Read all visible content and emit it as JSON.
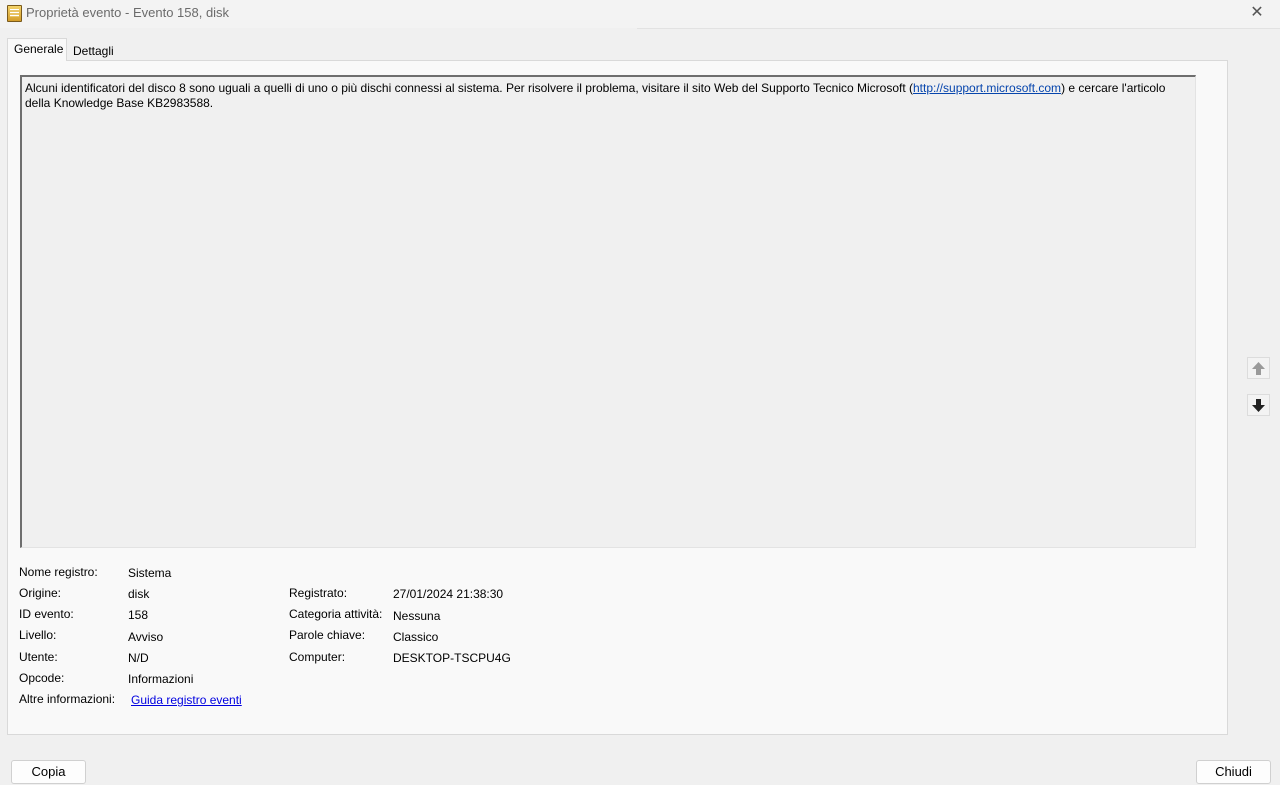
{
  "window": {
    "title": "Proprietà evento - Evento 158, disk",
    "close_glyph": "✕"
  },
  "tabs": [
    {
      "label": "Generale",
      "active": true
    },
    {
      "label": "Dettagli",
      "active": false
    }
  ],
  "description": {
    "text_before_link": "Alcuni identificatori del disco 8 sono uguali a quelli di uno o più dischi connessi al sistema. Per risolvere il problema, visitare il sito Web del Supporto Tecnico Microsoft (",
    "link": "http://support.microsoft.com",
    "text_after_link": ") e cercare l'articolo della Knowledge Base KB2983588."
  },
  "fields": {
    "log_name": {
      "label": "Nome registro:",
      "value": "Sistema"
    },
    "source": {
      "label": "Origine:",
      "value": "disk"
    },
    "logged": {
      "label": "Registrato:",
      "value": "27/01/2024 21:38:30"
    },
    "event_id": {
      "label": "ID evento:",
      "value": "158"
    },
    "task_category": {
      "label": "Categoria attività:",
      "value": "Nessuna"
    },
    "level": {
      "label": "Livello:",
      "value": "Avviso"
    },
    "keywords": {
      "label": "Parole chiave:",
      "value": "Classico"
    },
    "user": {
      "label": "Utente:",
      "value": "N/D"
    },
    "computer": {
      "label": "Computer:",
      "value": "DESKTOP-TSCPU4G"
    },
    "opcode": {
      "label": "Opcode:",
      "value": "Informazioni"
    },
    "more_info": {
      "label": "Altre informazioni:",
      "link": "Guida registro eventi"
    }
  },
  "nav": {
    "up_icon": "arrow-up",
    "down_icon": "arrow-down"
  },
  "buttons": {
    "copy": "Copia",
    "close": "Chiudi"
  },
  "colors": {
    "link": "#0645ad",
    "background": "#f0f0f0"
  }
}
